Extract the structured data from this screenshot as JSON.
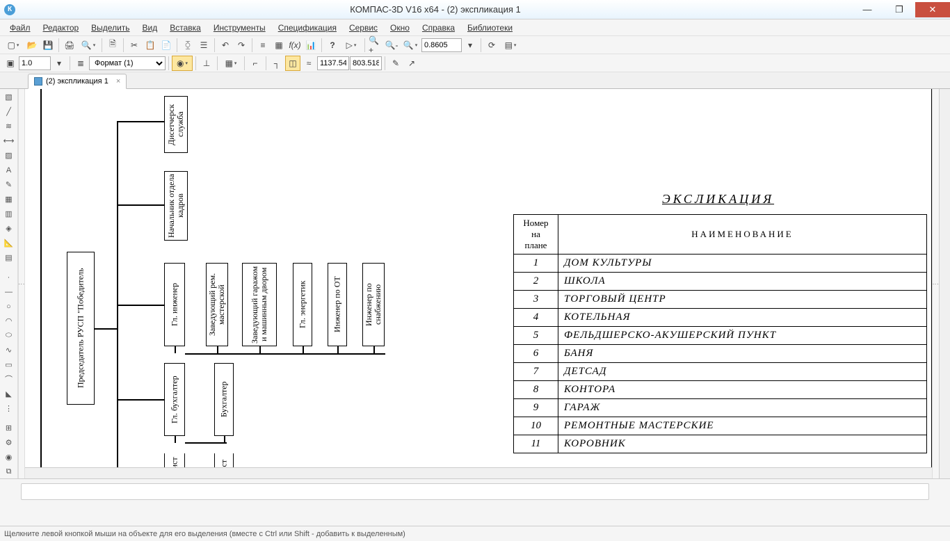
{
  "window": {
    "title": "КОМПАС-3D V16  x64 - (2) экспликация 1",
    "app_letter": "К"
  },
  "menu": [
    "Файл",
    "Редактор",
    "Выделить",
    "Вид",
    "Вставка",
    "Инструменты",
    "Спецификация",
    "Сервис",
    "Окно",
    "Справка",
    "Библиотеки"
  ],
  "toolbar1": {
    "zoom_value": "0.8605"
  },
  "toolbar2": {
    "scale": "1.0",
    "format": "Формат (1)",
    "coord_x": "1137.54",
    "coord_y": "803.518"
  },
  "tab": {
    "label": "(2) экспликация 1"
  },
  "org": {
    "root": "Председатель РУСП \"Победитель",
    "b1": "Дисетчерск служба",
    "b2": "Начальник отдела кадров",
    "b3": "Гл. инженер",
    "b4": "Заведующий рем. мастерской",
    "b5": "Заведующий гаражом и машинным двором",
    "b6": "Гл. энергетик",
    "b7": "Инженер по ОТ",
    "b8": "Инженер по снабжению",
    "b9": "Гл. бухгалтер",
    "b10": "Бухгалтер",
    "b11": "мист",
    "b12": "ист"
  },
  "explication": {
    "title": "ЭКСЛИКАЦИЯ",
    "header_num": "Номер на плане",
    "header_name": "НАИМЕНОВАНИЕ",
    "rows": [
      {
        "n": "1",
        "name": "ДОМ КУЛЬТУРЫ"
      },
      {
        "n": "2",
        "name": "ШКОЛА"
      },
      {
        "n": "3",
        "name": "ТОРГОВЫЙ ЦЕНТР"
      },
      {
        "n": "4",
        "name": "КОТЕЛЬНАЯ"
      },
      {
        "n": "5",
        "name": "ФЕЛЬДШЕРСКО-АКУШЕРСКИЙ ПУНКТ"
      },
      {
        "n": "6",
        "name": "БАНЯ"
      },
      {
        "n": "7",
        "name": "ДЕТСАД"
      },
      {
        "n": "8",
        "name": "КОНТОРА"
      },
      {
        "n": "9",
        "name": "ГАРАЖ"
      },
      {
        "n": "10",
        "name": "РЕМОНТНЫЕ МАСТЕРСКИЕ"
      },
      {
        "n": "11",
        "name": "КОРОВНИК"
      }
    ]
  },
  "status": "Щелкните левой кнопкой мыши на объекте для его выделения (вместе с Ctrl или Shift - добавить к выделенным)"
}
